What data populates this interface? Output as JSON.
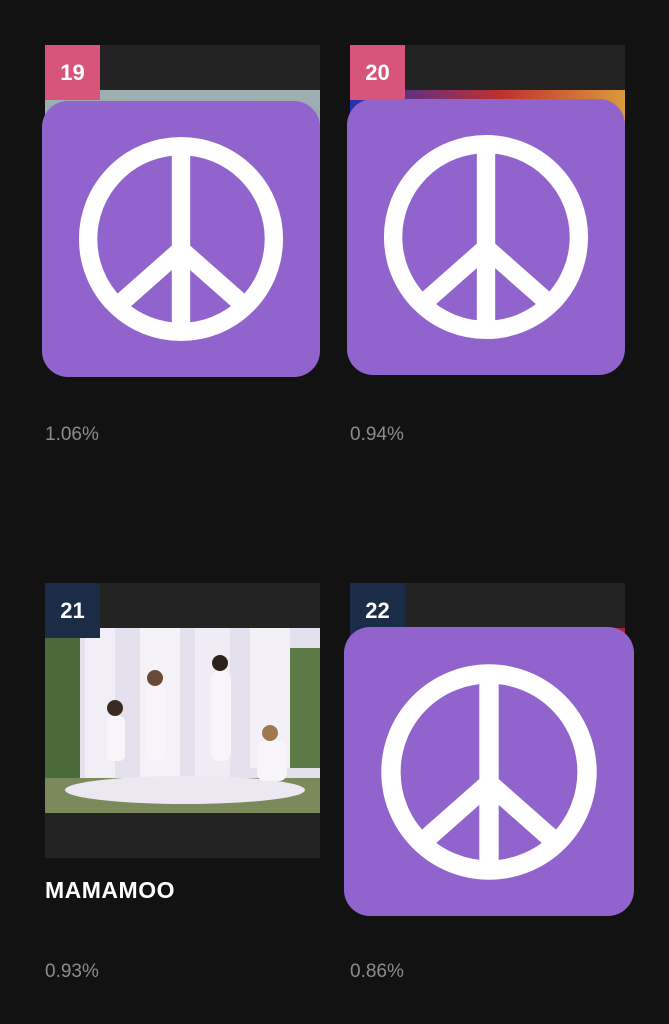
{
  "colors": {
    "background": "#121212",
    "card": "#232323",
    "rank_pink": "#d7547a",
    "rank_navy": "#1b2c47",
    "peace_purple": "#9063cd",
    "name": "#ffffff",
    "percent": "#8c8c8c"
  },
  "entries": [
    {
      "rank": "19",
      "name": "",
      "percent": "1.06%",
      "thumbnail": "peace-emoji"
    },
    {
      "rank": "20",
      "name": "",
      "percent": "0.94%",
      "thumbnail": "peace-emoji"
    },
    {
      "rank": "21",
      "name": "MAMAMOO",
      "percent": "0.93%",
      "thumbnail": "group-photo"
    },
    {
      "rank": "22",
      "name": "",
      "percent": "0.86%",
      "thumbnail": "peace-emoji"
    }
  ]
}
